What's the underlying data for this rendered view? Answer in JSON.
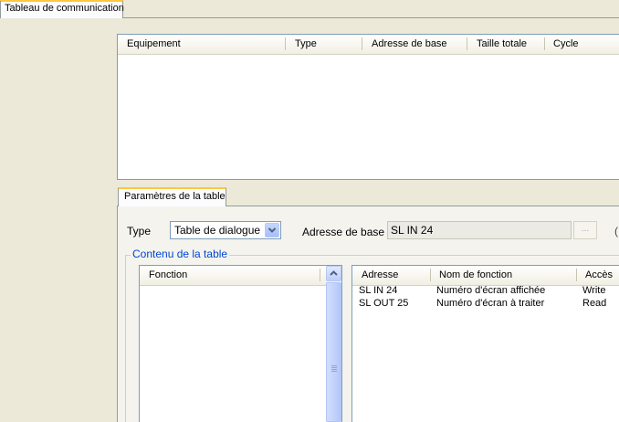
{
  "tabs": {
    "communication": "Tableau de communication",
    "params": "Paramètres de la table"
  },
  "equipment_list": {
    "columns": [
      "Equipement",
      "Type",
      "Adresse de base",
      "Taille totale",
      "Cycle"
    ],
    "rows": []
  },
  "params": {
    "type_label": "Type",
    "type_value": "Table de dialogue",
    "base_label": "Adresse de base",
    "base_value": "SL IN 24",
    "browse_label": "...",
    "edge_char": "("
  },
  "contenu": {
    "legend": "Contenu de la table",
    "fonction_header": "Fonction",
    "fonction_rows": [],
    "columns": [
      "Adresse",
      "Nom de fonction",
      "Accès"
    ],
    "rows": [
      {
        "adresse": "SL IN 24",
        "nom": "Numéro d'écran affichée",
        "acces": "Write"
      },
      {
        "adresse": "SL OUT 25",
        "nom": "Numéro d'écran à traiter",
        "acces": "Read"
      }
    ]
  },
  "icons": {
    "dropdown": "chevron-down-icon",
    "scroll_up": "arrow-up-icon",
    "scroll_grip": "grip-icon"
  }
}
